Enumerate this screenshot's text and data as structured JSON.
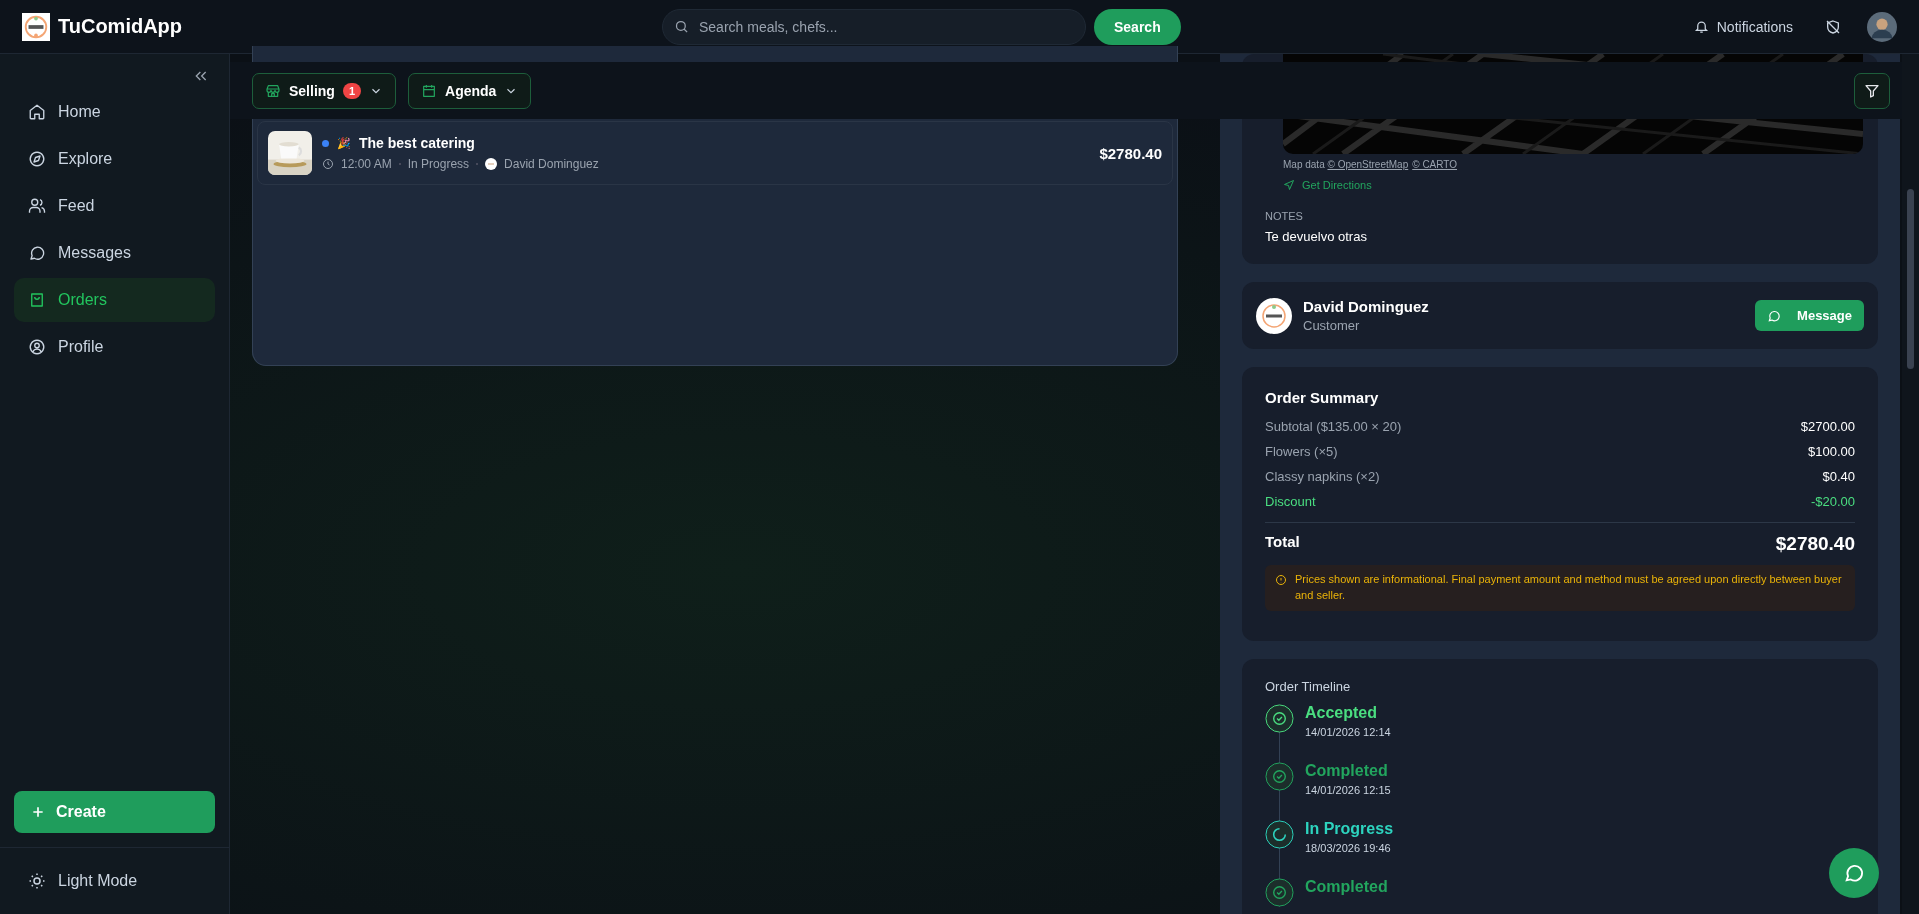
{
  "app": {
    "name": "TuComidApp"
  },
  "search": {
    "placeholder": "Search meals, chefs...",
    "button": "Search"
  },
  "header": {
    "notifications": "Notifications"
  },
  "sidebar": {
    "items": [
      {
        "label": "Home",
        "selected": false
      },
      {
        "label": "Explore",
        "selected": false
      },
      {
        "label": "Feed",
        "selected": false
      },
      {
        "label": "Messages",
        "selected": false
      },
      {
        "label": "Orders",
        "selected": true
      },
      {
        "label": "Profile",
        "selected": false
      }
    ],
    "create": "Create",
    "theme": "Light Mode"
  },
  "filters": [
    {
      "label": "Selling",
      "badge": "1"
    },
    {
      "label": "Agenda"
    }
  ],
  "orders": [
    {
      "title": "The best catering",
      "emoji": "🎉",
      "time": "12:00 AM",
      "status": "In Progress",
      "customer": "David Dominguez",
      "price": "$2780.40",
      "color": "#3b82f6"
    }
  ],
  "map": {
    "attribution_prefix": "Map data",
    "links": [
      "© OpenStreetMap",
      "© CARTO"
    ],
    "directions": "Get Directions"
  },
  "notes": {
    "label": "NOTES",
    "text": "Te devuelvo otras"
  },
  "customer": {
    "name": "David Dominguez",
    "role": "Customer",
    "button": "Message"
  },
  "summary": {
    "title": "Order Summary",
    "lines": [
      {
        "label": "Subtotal ($135.00 × 20)",
        "value": "$2700.00",
        "kind": "normal"
      },
      {
        "label": "Flowers (×5)",
        "value": "$100.00",
        "kind": "normal"
      },
      {
        "label": "Classy napkins (×2)",
        "value": "$0.40",
        "kind": "normal"
      },
      {
        "label": "Discount",
        "value": "-$20.00",
        "kind": "discount"
      }
    ],
    "total_label": "Total",
    "total": "$2780.40",
    "notice": "Prices shown are informational. Final payment amount and method must be agreed upon directly between buyer and seller."
  },
  "timeline": {
    "title": "Order Timeline",
    "events": [
      {
        "label": "Accepted",
        "date": "14/01/2026 12:14",
        "kind": "accepted"
      },
      {
        "label": "Completed",
        "date": "14/01/2026 12:15",
        "kind": "completed"
      },
      {
        "label": "In Progress",
        "date": "18/03/2026 19:46",
        "kind": "progress"
      },
      {
        "label": "Completed",
        "kind": "completed"
      }
    ]
  }
}
